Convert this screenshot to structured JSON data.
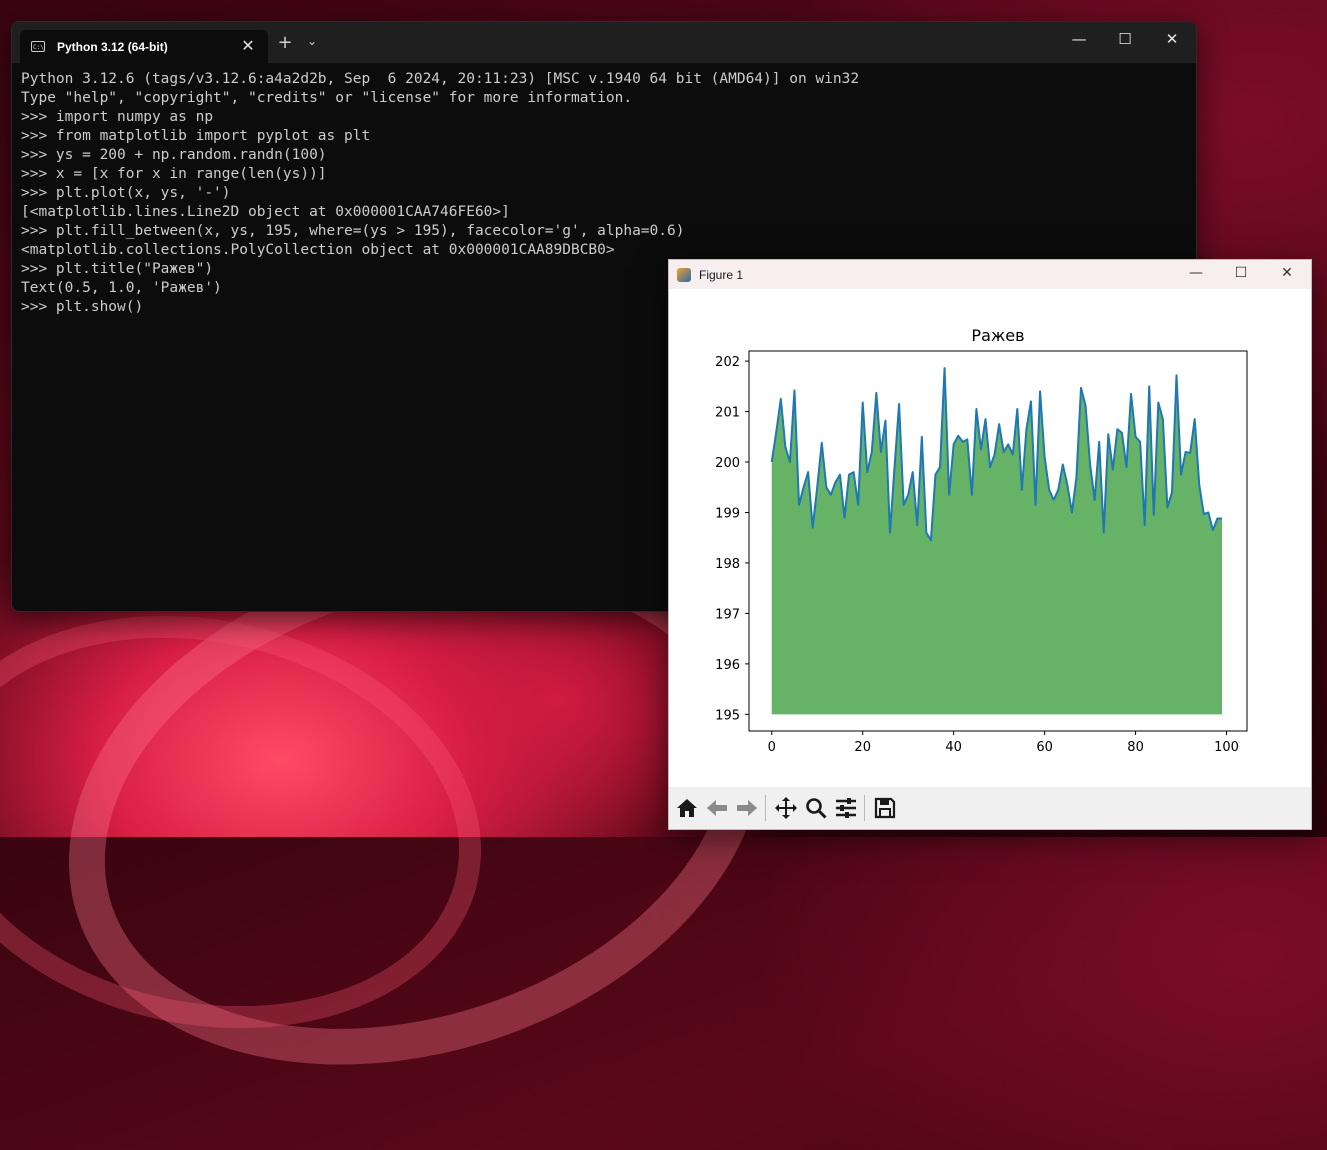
{
  "terminal": {
    "tab_title": "Python 3.12 (64-bit)",
    "tab_icon": "console-icon",
    "new_tab_label": "+",
    "lines": [
      "Python 3.12.6 (tags/v3.12.6:a4a2d2b, Sep  6 2024, 20:11:23) [MSC v.1940 64 bit (AMD64)] on win32",
      "Type \"help\", \"copyright\", \"credits\" or \"license\" for more information.",
      ">>> import numpy as np",
      ">>> from matplotlib import pyplot as plt",
      ">>> ys = 200 + np.random.randn(100)",
      ">>> x = [x for x in range(len(ys))]",
      ">>> plt.plot(x, ys, '-')",
      "[<matplotlib.lines.Line2D object at 0x000001CAA746FE60>]",
      ">>> plt.fill_between(x, ys, 195, where=(ys > 195), facecolor='g', alpha=0.6)",
      "<matplotlib.collections.PolyCollection object at 0x000001CAA89DBCB0>",
      ">>> plt.title(\"Ражев\")",
      "Text(0.5, 1.0, 'Ражев')",
      ">>> plt.show()"
    ]
  },
  "figure": {
    "window_title": "Figure 1",
    "toolbar": [
      "home-icon",
      "back-icon",
      "forward-icon",
      "pan-icon",
      "zoom-icon",
      "configure-subplots-icon",
      "save-icon"
    ]
  },
  "chart_data": {
    "type": "line",
    "title": "Ражев",
    "xlabel": "",
    "ylabel": "",
    "xlim": [
      -5,
      104.5
    ],
    "ylim": [
      194.67,
      202.2
    ],
    "xticks": [
      0,
      20,
      40,
      60,
      80,
      100
    ],
    "yticks": [
      195,
      196,
      197,
      198,
      199,
      200,
      201,
      202
    ],
    "fill_baseline": 195,
    "fill_color": "#66b266",
    "line_color": "#1f77b4",
    "grid": false,
    "x": [
      0,
      1,
      2,
      3,
      4,
      5,
      6,
      7,
      8,
      9,
      10,
      11,
      12,
      13,
      14,
      15,
      16,
      17,
      18,
      19,
      20,
      21,
      22,
      23,
      24,
      25,
      26,
      27,
      28,
      29,
      30,
      31,
      32,
      33,
      34,
      35,
      36,
      37,
      38,
      39,
      40,
      41,
      42,
      43,
      44,
      45,
      46,
      47,
      48,
      49,
      50,
      51,
      52,
      53,
      54,
      55,
      56,
      57,
      58,
      59,
      60,
      61,
      62,
      63,
      64,
      65,
      66,
      67,
      68,
      69,
      70,
      71,
      72,
      73,
      74,
      75,
      76,
      77,
      78,
      79,
      80,
      81,
      82,
      83,
      84,
      85,
      86,
      87,
      88,
      89,
      90,
      91,
      92,
      93,
      94,
      95,
      96,
      97,
      98,
      99
    ],
    "values": [
      200.0,
      200.6,
      201.25,
      200.3,
      200.0,
      201.42,
      199.15,
      199.5,
      199.8,
      198.7,
      199.5,
      200.38,
      199.5,
      199.35,
      199.6,
      199.75,
      198.9,
      199.75,
      199.8,
      199.15,
      201.18,
      199.8,
      200.2,
      201.37,
      200.2,
      200.82,
      198.6,
      199.9,
      201.15,
      199.15,
      199.35,
      199.8,
      198.75,
      200.5,
      198.6,
      198.45,
      199.75,
      199.9,
      201.86,
      199.35,
      200.35,
      200.52,
      200.4,
      200.45,
      199.35,
      201.05,
      200.25,
      200.85,
      199.9,
      200.15,
      200.75,
      200.2,
      200.35,
      200.15,
      201.05,
      199.45,
      200.65,
      201.2,
      199.15,
      201.4,
      200.1,
      199.45,
      199.25,
      199.45,
      199.95,
      199.55,
      199.0,
      199.7,
      201.47,
      201.12,
      199.95,
      199.25,
      200.4,
      198.6,
      200.55,
      199.85,
      200.65,
      200.58,
      199.9,
      201.35,
      200.5,
      200.4,
      198.75,
      201.5,
      198.95,
      201.18,
      200.85,
      199.1,
      199.4,
      201.72,
      199.75,
      200.2,
      200.18,
      200.85,
      199.55,
      198.97,
      199.0,
      198.65,
      198.88,
      198.88
    ]
  }
}
